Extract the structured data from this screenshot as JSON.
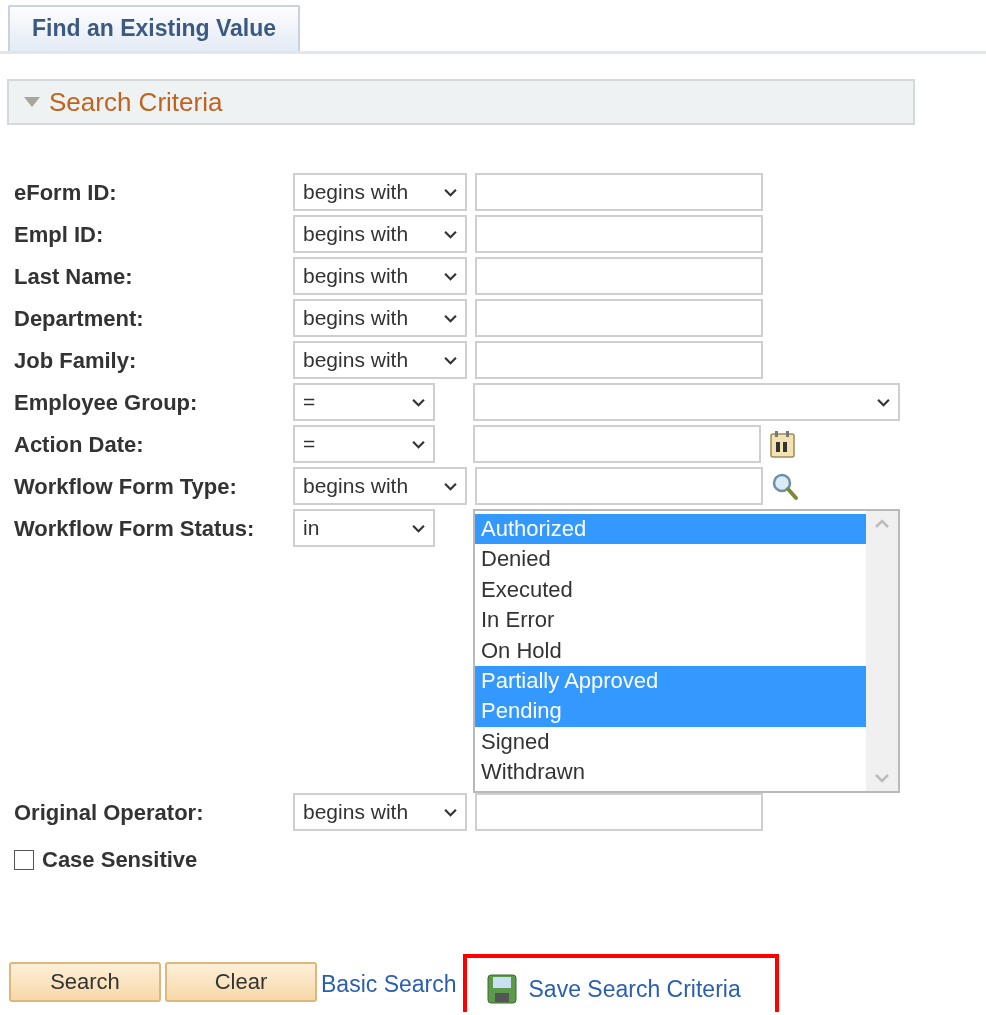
{
  "tabs": [
    {
      "label": "Find an Existing Value",
      "selected": true
    }
  ],
  "section": {
    "title": "Search Criteria",
    "expanded": true
  },
  "fields": [
    {
      "kind": "text",
      "label": "eForm ID:",
      "operator": "begins with"
    },
    {
      "kind": "text",
      "label": "Empl ID:",
      "operator": "begins with"
    },
    {
      "kind": "text",
      "label": "Last Name:",
      "operator": "begins with"
    },
    {
      "kind": "text",
      "label": "Department:",
      "operator": "begins with"
    },
    {
      "kind": "text",
      "label": "Job Family:",
      "operator": "begins with"
    },
    {
      "kind": "select",
      "label": "Employee Group:",
      "operator": "="
    },
    {
      "kind": "date",
      "label": "Action Date:",
      "operator": "="
    },
    {
      "kind": "lookup",
      "label": "Workflow Form Type:",
      "operator": "begins with"
    },
    {
      "kind": "listbox",
      "label": "Workflow Form Status:",
      "operator": "in",
      "options": [
        {
          "label": "Authorized",
          "selected": true
        },
        {
          "label": "Denied",
          "selected": false
        },
        {
          "label": "Executed",
          "selected": false
        },
        {
          "label": "In Error",
          "selected": false
        },
        {
          "label": "On Hold",
          "selected": false
        },
        {
          "label": "Partially Approved",
          "selected": true
        },
        {
          "label": "Pending",
          "selected": true
        },
        {
          "label": "Signed",
          "selected": false
        },
        {
          "label": "Withdrawn",
          "selected": false
        }
      ]
    },
    {
      "kind": "text",
      "label": "Original Operator:",
      "operator": "begins with"
    }
  ],
  "case_sensitive": {
    "label": "Case Sensitive",
    "checked": false
  },
  "buttons": [
    "Search",
    "Clear"
  ],
  "basic_search_link": "Basic Search",
  "save_link": "Save Search Criteria"
}
